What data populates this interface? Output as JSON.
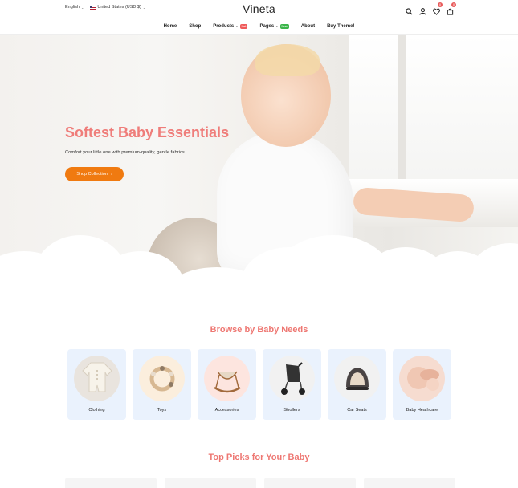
{
  "topbar": {
    "language": "English",
    "currency": "United States (USD $)",
    "logo": "Vineta",
    "wishlist_count": "0",
    "cart_count": "0"
  },
  "nav": {
    "items": [
      {
        "label": "Home"
      },
      {
        "label": "Shop"
      },
      {
        "label": "Products",
        "tag": "Hot"
      },
      {
        "label": "Pages",
        "tag": "New"
      },
      {
        "label": "About"
      },
      {
        "label": "Buy Theme!"
      }
    ]
  },
  "hero": {
    "title": "Softest Baby Essentials",
    "subtitle": "Comfort your little one with premium-quality, gentle fabrics",
    "button": "Shop Collection",
    "button_icon": "chevron-right-icon"
  },
  "categories": {
    "title": "Browse by Baby Needs",
    "items": [
      {
        "label": "Clothing",
        "icon": "onesie-icon"
      },
      {
        "label": "Toys",
        "icon": "teether-ring-icon"
      },
      {
        "label": "Accessories",
        "icon": "rocker-icon"
      },
      {
        "label": "Strollers",
        "icon": "stroller-icon"
      },
      {
        "label": "Car Seats",
        "icon": "car-seat-icon"
      },
      {
        "label": "Baby Heathcare",
        "icon": "baby-care-icon"
      }
    ]
  },
  "picks": {
    "title": "Top Picks for Your Baby"
  },
  "colors": {
    "accent_pink": "#ef7d7a",
    "button_orange": "#f07a10",
    "card_bg": "#eaf2fd"
  }
}
